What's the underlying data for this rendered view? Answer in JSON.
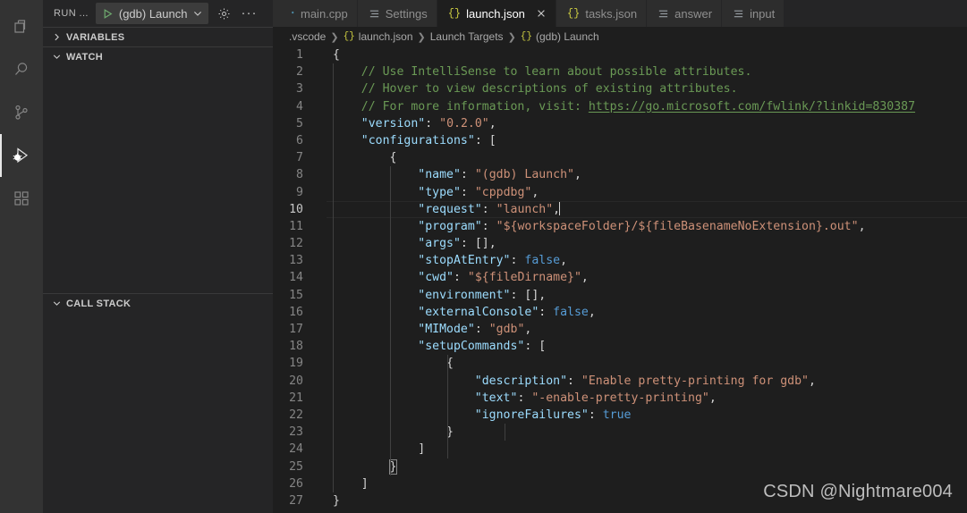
{
  "activitybar": {
    "items": [
      {
        "name": "explorer-icon",
        "label": "Explorer",
        "active": false
      },
      {
        "name": "search-icon",
        "label": "Search",
        "active": false
      },
      {
        "name": "source-control-icon",
        "label": "Source Control",
        "active": false
      },
      {
        "name": "run-and-debug-icon",
        "label": "Run and Debug",
        "active": true
      },
      {
        "name": "extensions-icon",
        "label": "Extensions",
        "active": false
      }
    ]
  },
  "sidebar": {
    "title": "RUN ...",
    "launch_config": "(gdb) Launch",
    "gear_label": "Open launch.json",
    "more_label": "Views and More Actions...",
    "panes": [
      {
        "label": "VARIABLES",
        "expanded": false
      },
      {
        "label": "WATCH",
        "expanded": true
      },
      {
        "label": "CALL STACK",
        "expanded": true
      }
    ]
  },
  "tabs": [
    {
      "label": "main.cpp",
      "icon": "cpp-file-icon",
      "active": false,
      "closable": false
    },
    {
      "label": "Settings",
      "icon": "settings-file-icon",
      "active": false,
      "closable": false
    },
    {
      "label": "launch.json",
      "icon": "json-file-icon",
      "active": true,
      "closable": true
    },
    {
      "label": "tasks.json",
      "icon": "json-file-icon",
      "active": false,
      "closable": false
    },
    {
      "label": "answer",
      "icon": "text-file-icon",
      "active": false,
      "closable": false
    },
    {
      "label": "input",
      "icon": "text-file-icon",
      "active": false,
      "closable": false
    }
  ],
  "breadcrumb": [
    {
      "label": ".vscode",
      "icon": null
    },
    {
      "label": "launch.json",
      "icon": "json-file-icon"
    },
    {
      "label": "Launch Targets",
      "icon": null
    },
    {
      "label": "(gdb) Launch",
      "icon": "json-node-icon"
    }
  ],
  "editor": {
    "current_line": 10,
    "link_url": "https://go.microsoft.com/fwlink/?linkid=830387",
    "lines": [
      {
        "n": 1,
        "text": "{"
      },
      {
        "n": 2,
        "text": "    // Use IntelliSense to learn about possible attributes."
      },
      {
        "n": 3,
        "text": "    // Hover to view descriptions of existing attributes."
      },
      {
        "n": 4,
        "text": "    // For more information, visit: https://go.microsoft.com/fwlink/?linkid=830387"
      },
      {
        "n": 5,
        "text": "    \"version\": \"0.2.0\","
      },
      {
        "n": 6,
        "text": "    \"configurations\": ["
      },
      {
        "n": 7,
        "text": "        {"
      },
      {
        "n": 8,
        "text": "            \"name\": \"(gdb) Launch\","
      },
      {
        "n": 9,
        "text": "            \"type\": \"cppdbg\","
      },
      {
        "n": 10,
        "text": "            \"request\": \"launch\","
      },
      {
        "n": 11,
        "text": "            \"program\": \"${workspaceFolder}/${fileBasenameNoExtension}.out\","
      },
      {
        "n": 12,
        "text": "            \"args\": [],"
      },
      {
        "n": 13,
        "text": "            \"stopAtEntry\": false,"
      },
      {
        "n": 14,
        "text": "            \"cwd\": \"${fileDirname}\","
      },
      {
        "n": 15,
        "text": "            \"environment\": [],"
      },
      {
        "n": 16,
        "text": "            \"externalConsole\": false,"
      },
      {
        "n": 17,
        "text": "            \"MIMode\": \"gdb\","
      },
      {
        "n": 18,
        "text": "            \"setupCommands\": ["
      },
      {
        "n": 19,
        "text": "                {"
      },
      {
        "n": 20,
        "text": "                    \"description\": \"Enable pretty-printing for gdb\","
      },
      {
        "n": 21,
        "text": "                    \"text\": \"-enable-pretty-printing\","
      },
      {
        "n": 22,
        "text": "                    \"ignoreFailures\": true"
      },
      {
        "n": 23,
        "text": "                }"
      },
      {
        "n": 24,
        "text": "            ]"
      },
      {
        "n": 25,
        "text": "        }"
      },
      {
        "n": 26,
        "text": "    ]"
      },
      {
        "n": 27,
        "text": "}"
      }
    ]
  },
  "watermark": "CSDN @Nightmare004",
  "colors": {
    "editor_bg": "#1e1e1e",
    "sidebar_bg": "#252526",
    "activitybar_bg": "#333333",
    "tab_inactive_bg": "#2d2d2d",
    "comment": "#6a9955",
    "key": "#9cdcfe",
    "string": "#ce9178",
    "boolean": "#569cd6",
    "punctuation": "#d4d4d4",
    "linenumber": "#858585",
    "accent_play": "#6ea96e"
  }
}
